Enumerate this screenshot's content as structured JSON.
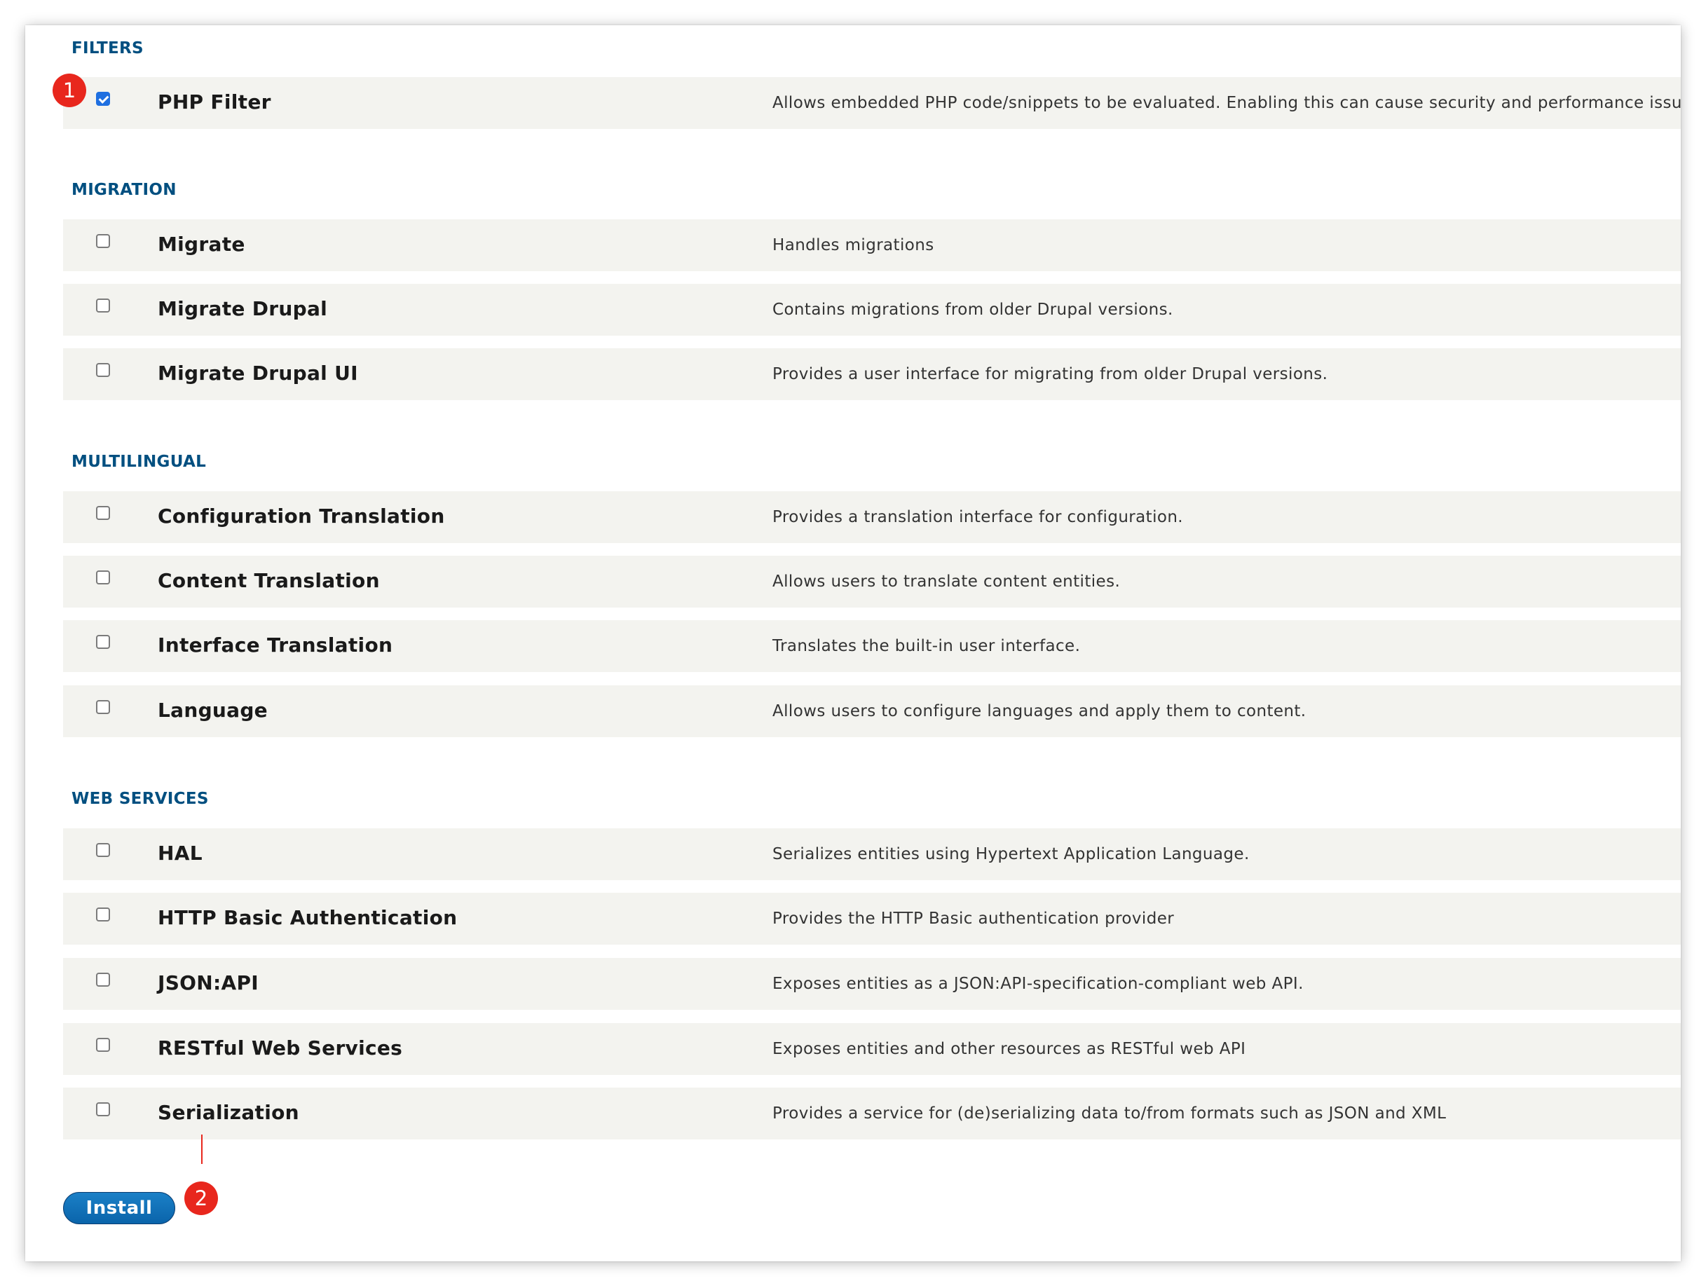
{
  "sections": [
    {
      "title": "FILTERS",
      "modules": [
        {
          "name": "PHP Filter",
          "description": "Allows embedded PHP code/snippets to be evaluated. Enabling this can cause security and performance issues as it a",
          "checked": true
        }
      ]
    },
    {
      "title": "MIGRATION",
      "modules": [
        {
          "name": "Migrate",
          "description": "Handles migrations",
          "checked": false
        },
        {
          "name": "Migrate Drupal",
          "description": "Contains migrations from older Drupal versions.",
          "checked": false
        },
        {
          "name": "Migrate Drupal UI",
          "description": "Provides a user interface for migrating from older Drupal versions.",
          "checked": false
        }
      ]
    },
    {
      "title": "MULTILINGUAL",
      "modules": [
        {
          "name": "Configuration Translation",
          "description": "Provides a translation interface for configuration.",
          "checked": false
        },
        {
          "name": "Content Translation",
          "description": "Allows users to translate content entities.",
          "checked": false
        },
        {
          "name": "Interface Translation",
          "description": "Translates the built-in user interface.",
          "checked": false
        },
        {
          "name": "Language",
          "description": "Allows users to configure languages and apply them to content.",
          "checked": false
        }
      ]
    },
    {
      "title": "WEB SERVICES",
      "modules": [
        {
          "name": "HAL",
          "description": "Serializes entities using Hypertext Application Language.",
          "checked": false
        },
        {
          "name": "HTTP Basic Authentication",
          "description": "Provides the HTTP Basic authentication provider",
          "checked": false
        },
        {
          "name": "JSON:API",
          "description": "Exposes entities as a JSON:API-specification-compliant web API.",
          "checked": false
        },
        {
          "name": "RESTful Web Services",
          "description": "Exposes entities and other resources as RESTful web API",
          "checked": false
        },
        {
          "name": "Serialization",
          "description": "Provides a service for (de)serializing data to/from formats such as JSON and XML",
          "checked": false
        }
      ]
    }
  ],
  "install_button": {
    "label": "Install"
  },
  "callouts": {
    "first": "1",
    "second": "2"
  },
  "colors": {
    "section_title": "#004f80",
    "row_background": "#f3f3ef",
    "button": "#0a64aa",
    "callout": "#e8271d"
  }
}
